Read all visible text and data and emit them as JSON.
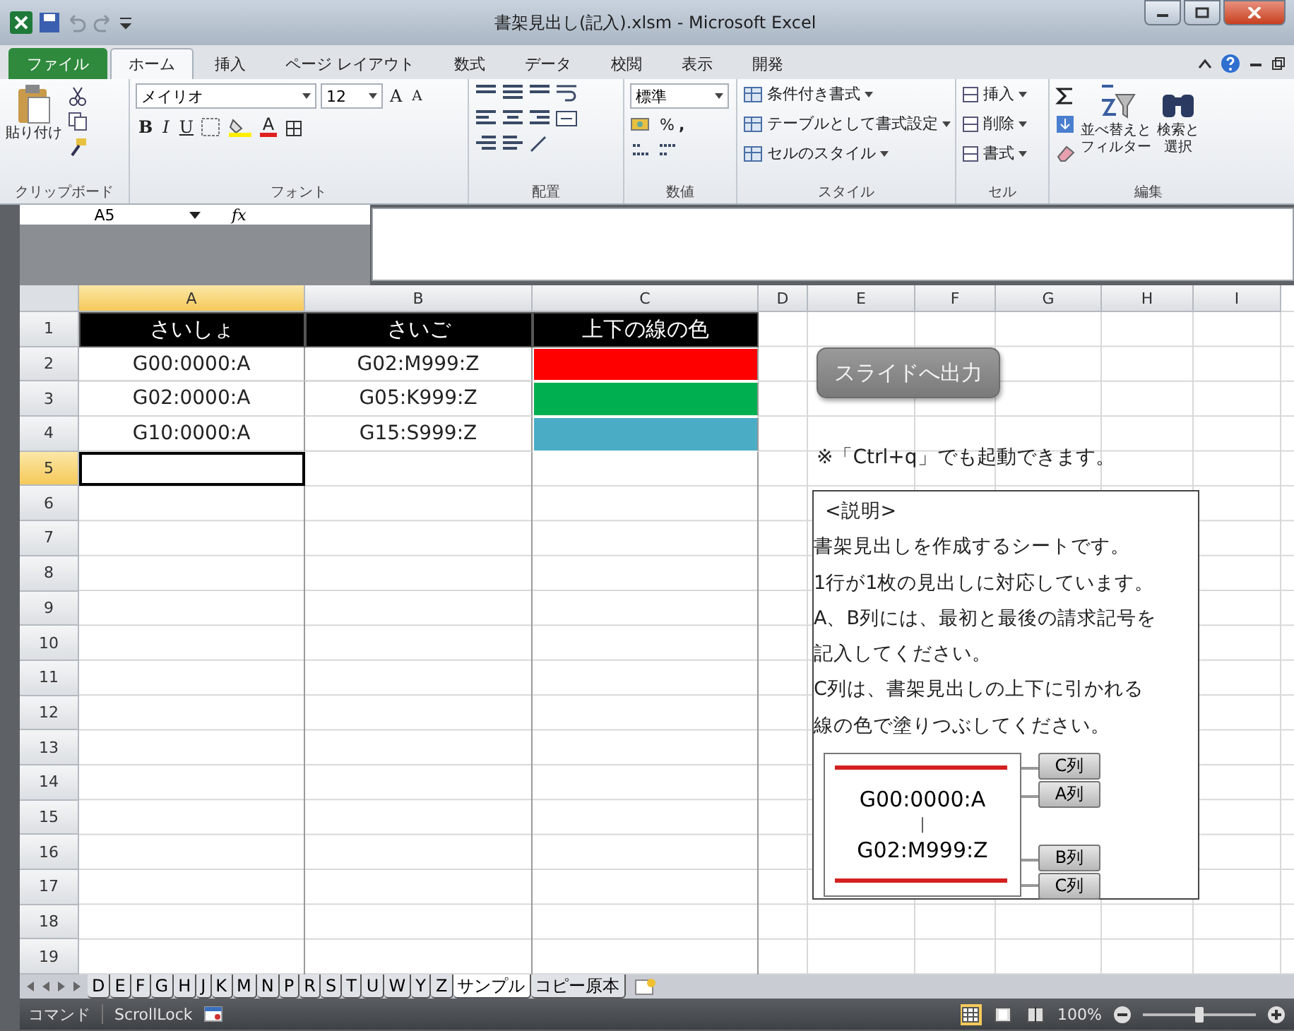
{
  "window": {
    "title": "書架見出し(記入).xlsm - Microsoft Excel"
  },
  "ribbon_tabs": [
    {
      "label": "ファイル",
      "kind": "file",
      "selected": false
    },
    {
      "label": "ホーム",
      "kind": "tab",
      "selected": true
    },
    {
      "label": "挿入",
      "kind": "tab",
      "selected": false
    },
    {
      "label": "ページ レイアウト",
      "kind": "tab",
      "selected": false
    },
    {
      "label": "数式",
      "kind": "tab",
      "selected": false
    },
    {
      "label": "データ",
      "kind": "tab",
      "selected": false
    },
    {
      "label": "校閲",
      "kind": "tab",
      "selected": false
    },
    {
      "label": "表示",
      "kind": "tab",
      "selected": false
    },
    {
      "label": "開発",
      "kind": "tab",
      "selected": false
    }
  ],
  "ribbon": {
    "clipboard": {
      "paste": "貼り付け",
      "label": "クリップボード"
    },
    "font": {
      "name": "メイリオ",
      "size": "12",
      "grow": "A",
      "shrink": "A",
      "bold": "B",
      "italic": "I",
      "underline": "U",
      "color_letter": "A",
      "label": "フォント"
    },
    "alignment": {
      "label": "配置"
    },
    "number": {
      "format": "標準",
      "percent": "%",
      "comma": ",",
      "label": "数値"
    },
    "styles": {
      "items": [
        "条件付き書式",
        "テーブルとして書式設定",
        "セルのスタイル"
      ],
      "label": "スタイル"
    },
    "cells": {
      "items": [
        "挿入",
        "削除",
        "書式"
      ],
      "label": "セル"
    },
    "editing": {
      "sort": [
        "並べ替えと",
        "フィルター"
      ],
      "find": [
        "検索と",
        "選択"
      ],
      "label": "編集"
    }
  },
  "formula_bar": {
    "name_box": "A5",
    "fx": "fx"
  },
  "sheet": {
    "columns": [
      {
        "label": "A",
        "selected": true
      },
      {
        "label": "B",
        "selected": false
      },
      {
        "label": "C",
        "selected": false
      },
      {
        "label": "D",
        "selected": false
      },
      {
        "label": "E",
        "selected": false
      },
      {
        "label": "F",
        "selected": false
      },
      {
        "label": "G",
        "selected": false
      },
      {
        "label": "H",
        "selected": false
      },
      {
        "label": "I",
        "selected": false
      }
    ],
    "rows": [
      {
        "label": "1",
        "selected": false
      },
      {
        "label": "2",
        "selected": false
      },
      {
        "label": "3",
        "selected": false
      },
      {
        "label": "4",
        "selected": false
      },
      {
        "label": "5",
        "selected": true
      },
      {
        "label": "6",
        "selected": false
      },
      {
        "label": "7",
        "selected": false
      },
      {
        "label": "8",
        "selected": false
      },
      {
        "label": "9",
        "selected": false
      },
      {
        "label": "10",
        "selected": false
      },
      {
        "label": "11",
        "selected": false
      },
      {
        "label": "12",
        "selected": false
      },
      {
        "label": "13",
        "selected": false
      },
      {
        "label": "14",
        "selected": false
      },
      {
        "label": "15",
        "selected": false
      },
      {
        "label": "16",
        "selected": false
      },
      {
        "label": "17",
        "selected": false
      },
      {
        "label": "18",
        "selected": false
      },
      {
        "label": "19",
        "selected": false
      }
    ],
    "headers": [
      "さいしょ",
      "さいご",
      "上下の線の色"
    ],
    "entries": [
      {
        "first": "G00:0000:A",
        "last": "G02:M999:Z",
        "color": "#ff0000"
      },
      {
        "first": "G02:0000:A",
        "last": "G05:K999:Z",
        "color": "#00b050"
      },
      {
        "first": "G10:0000:A",
        "last": "G15:S999:Z",
        "color": "#4bacc6"
      }
    ],
    "macro_button": "スライドへ出力",
    "note": "※「Ctrl+q」でも起動できます。",
    "explanation": {
      "lines": [
        "<説明>",
        "書架見出しを作成するシートです。",
        "1行が1枚の見出しに対応しています。",
        "A、B列には、最初と最後の請求記号を",
        "記入してください。",
        "C列は、書架見出しの上下に引かれる",
        "線の色で塗りつぶしてください。"
      ],
      "diagram": {
        "first": "G00:0000:A",
        "separator": "|",
        "last": "G02:M999:Z",
        "callouts": [
          "C列",
          "A列",
          "B列",
          "C列"
        ]
      }
    }
  },
  "sheet_tabs": [
    {
      "label": "D",
      "selected": false
    },
    {
      "label": "E",
      "selected": false
    },
    {
      "label": "F",
      "selected": false
    },
    {
      "label": "G",
      "selected": false
    },
    {
      "label": "H",
      "selected": false
    },
    {
      "label": "J",
      "selected": false
    },
    {
      "label": "K",
      "selected": false
    },
    {
      "label": "M",
      "selected": false
    },
    {
      "label": "N",
      "selected": false
    },
    {
      "label": "P",
      "selected": false
    },
    {
      "label": "R",
      "selected": false
    },
    {
      "label": "S",
      "selected": false
    },
    {
      "label": "T",
      "selected": false
    },
    {
      "label": "U",
      "selected": false
    },
    {
      "label": "W",
      "selected": false
    },
    {
      "label": "Y",
      "selected": false
    },
    {
      "label": "Z",
      "selected": false
    },
    {
      "label": "サンプル",
      "selected": true
    },
    {
      "label": "コピー原本",
      "selected": false
    }
  ],
  "status_bar": {
    "mode": "コマンド",
    "scroll_lock": "ScrollLock",
    "views": [
      {
        "kind": "normal",
        "selected": true
      },
      {
        "kind": "layout",
        "selected": false
      },
      {
        "kind": "pagebreak",
        "selected": false
      }
    ],
    "zoom": "100%",
    "zoom_slider": {
      "level": 0.5
    }
  }
}
